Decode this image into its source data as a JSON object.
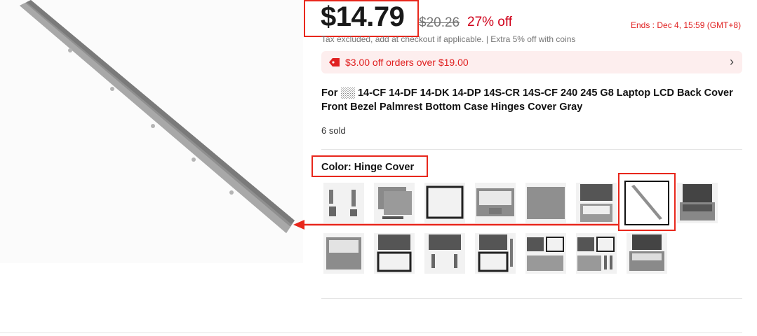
{
  "price": {
    "current": "$14.79",
    "original": "$20.26",
    "discount": "27% off",
    "ends": "Ends :  Dec 4, 15:59 (GMT+8)",
    "tax_note": "Tax excluded, add at checkout if applicable. | Extra 5% off with coins"
  },
  "coupon": {
    "text": "$3.00 off orders over $19.00",
    "icon": "tag-icon",
    "chevron": "›"
  },
  "product": {
    "title": "For ░░ 14-CF 14-DF 14-DK 14-DP 14S-CR 14S-CF 240 245 G8 Laptop LCD Back Cover Front Bezel Palmrest Bottom Case Hinges Cover Gray",
    "sold": "6 sold"
  },
  "variants": {
    "label": "Color: Hinge Cover",
    "selected": "Hinge Cover",
    "thumbs": [
      {
        "name": "hinges"
      },
      {
        "name": "back-cover"
      },
      {
        "name": "front-bezel"
      },
      {
        "name": "palmrest-keyboard"
      },
      {
        "name": "bottom-case"
      },
      {
        "name": "palmrest-set"
      },
      {
        "name": "hinge-cover"
      },
      {
        "name": "laptop-shell"
      },
      {
        "name": "palmrest"
      },
      {
        "name": "back-cover-bezel"
      },
      {
        "name": "back-cover-hinges"
      },
      {
        "name": "back-bezel-hinges"
      },
      {
        "name": "bezel-set"
      },
      {
        "name": "full-set-a"
      },
      {
        "name": "full-set-b"
      }
    ]
  },
  "colors": {
    "accent": "#e02020",
    "highlight": "#e8271c",
    "coupon_bg": "#fdeeee"
  }
}
